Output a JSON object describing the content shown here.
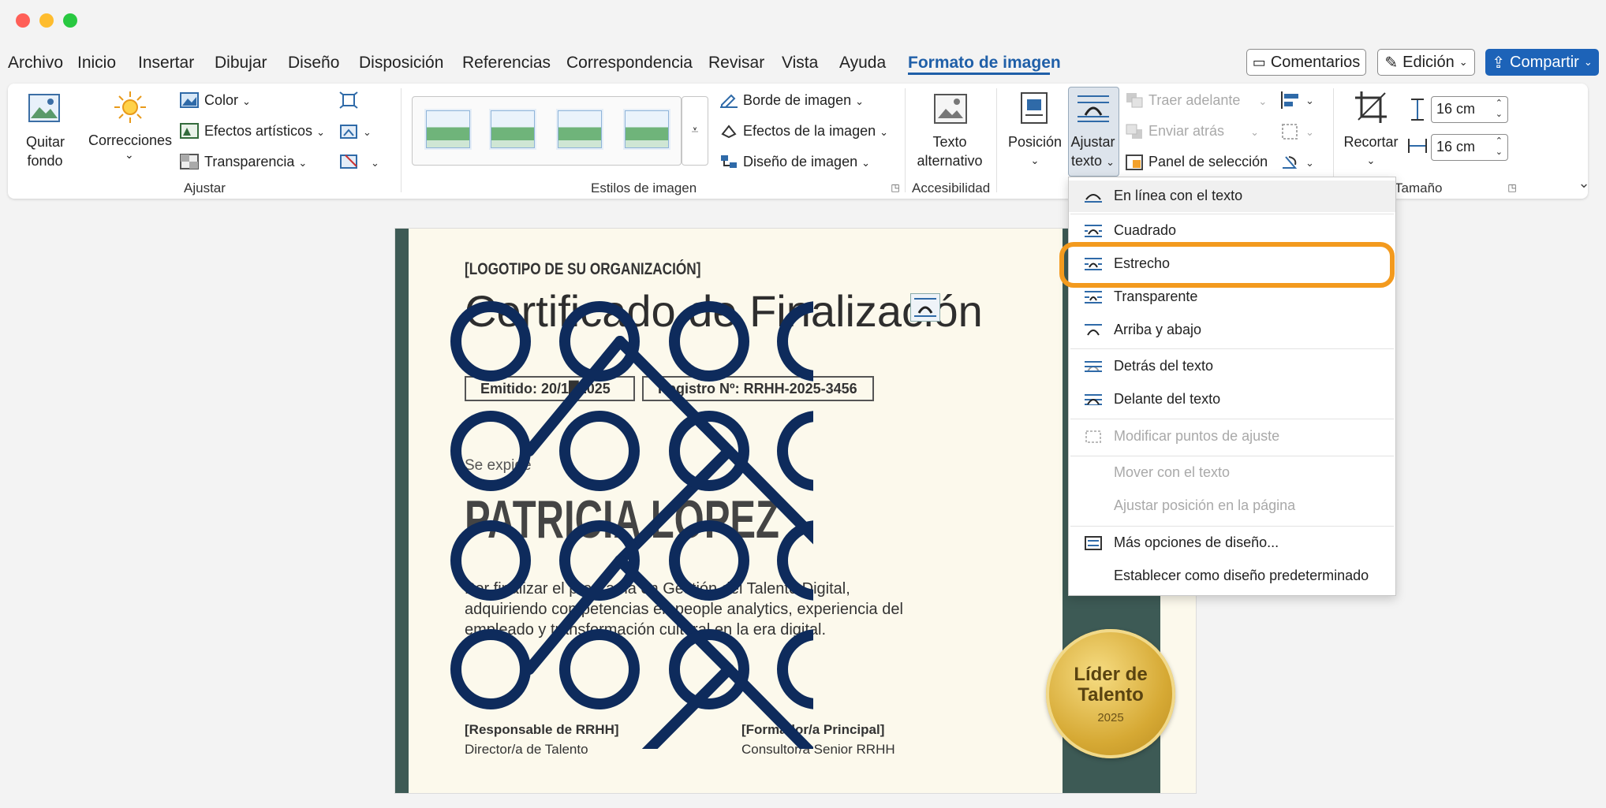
{
  "window": {
    "controls": [
      "close",
      "minimize",
      "maximize"
    ]
  },
  "tabs": [
    "Archivo",
    "Inicio",
    "Insertar",
    "Dibujar",
    "Diseño",
    "Disposición",
    "Referencias",
    "Correspondencia",
    "Revisar",
    "Vista",
    "Ayuda",
    "Formato de imagen"
  ],
  "active_tab": "Formato de imagen",
  "top_buttons": {
    "comments": "Comentarios",
    "editing": "Edición",
    "share": "Compartir"
  },
  "ribbon": {
    "adjust": {
      "remove_bg_line1": "Quitar",
      "remove_bg_line2": "fondo",
      "corrections": "Correcciones",
      "color": "Color",
      "artistic": "Efectos artísticos",
      "transparency": "Transparencia",
      "group_label": "Ajustar"
    },
    "styles": {
      "border": "Borde de imagen",
      "effects": "Efectos de la imagen",
      "layout": "Diseño de imagen",
      "group_label": "Estilos de imagen"
    },
    "accessibility": {
      "alt_line1": "Texto",
      "alt_line2": "alternativo",
      "group_label": "Accesibilidad"
    },
    "arrange": {
      "position": "Posición",
      "wrap_line1": "Ajustar",
      "wrap_line2": "texto",
      "bring_forward": "Traer adelante",
      "send_backward": "Enviar atrás",
      "selection_pane": "Panel de selección"
    },
    "size": {
      "crop": "Recortar",
      "height": "16 cm",
      "width": "16 cm",
      "group_label": "Tamaño"
    }
  },
  "document": {
    "logo_placeholder": "[LOGOTIPO DE SU ORGANIZACIÓN]",
    "title": "Certificado de Finalización",
    "issued": "Emitido: 20/1█2025",
    "registry": "Registro Nº: RRHH-2025-3456",
    "issued_to": "Se expide",
    "recipient": "PATRICIA LÓPEZ",
    "body_line1": "Por finalizar el programa en Gestión del Talento Digital,",
    "body_line2": "adquiriendo competencias en people analytics, experiencia del",
    "body_line3": "empleado y transformación cultural en la era digital.",
    "sign1_title": "[Responsable de RRHH]",
    "sign1_role": "Director/a de Talento",
    "sign2_title": "[Formador/a Principal]",
    "sign2_role": "Consultor/a Senior RRHH",
    "seal_line1": "Líder de",
    "seal_line2": "Talento",
    "seal_year": "2025"
  },
  "wrap_menu": {
    "items": [
      {
        "label": "En línea con el texto",
        "enabled": true
      },
      {
        "label": "Cuadrado",
        "enabled": true
      },
      {
        "label": "Estrecho",
        "enabled": true,
        "highlighted": true
      },
      {
        "label": "Transparente",
        "enabled": true
      },
      {
        "label": "Arriba y abajo",
        "enabled": true
      },
      {
        "label": "Detrás del texto",
        "enabled": true
      },
      {
        "label": "Delante del texto",
        "enabled": true
      },
      {
        "label": "Modificar puntos de ajuste",
        "enabled": false
      },
      {
        "label": "Mover con el texto",
        "enabled": false
      },
      {
        "label": "Ajustar posición en la página",
        "enabled": false
      },
      {
        "label": "Más opciones de diseño...",
        "enabled": true
      },
      {
        "label": "Establecer como diseño predeterminado",
        "enabled": true
      }
    ]
  },
  "colors": {
    "accent": "#1f5fa8",
    "highlight": "#f39a1e",
    "graphic": "#0e2b5c",
    "sidebar": "#3d5a55",
    "page": "#fcf9ec"
  }
}
